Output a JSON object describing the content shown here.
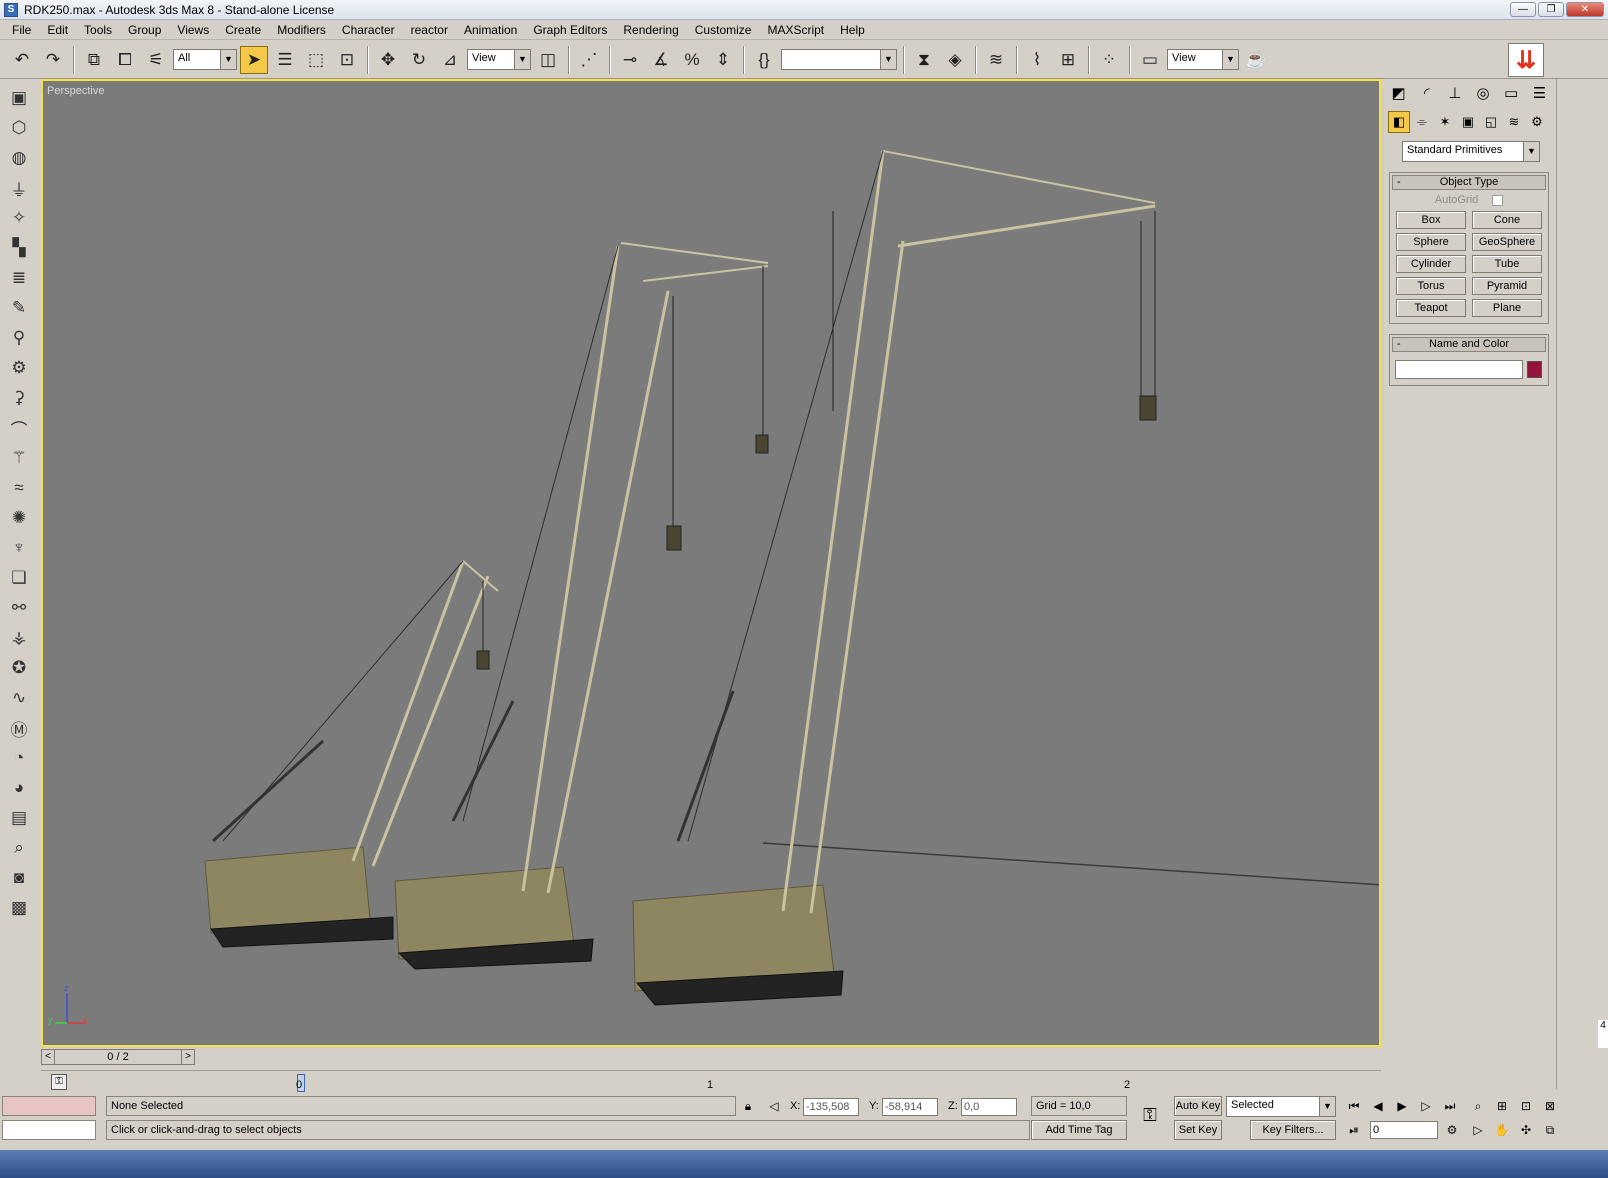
{
  "window": {
    "title": "RDK250.max - Autodesk 3ds Max 8  - Stand-alone License",
    "app_icon": "S",
    "minimize": "—",
    "maximize": "❐",
    "close": "✕"
  },
  "menu": [
    "File",
    "Edit",
    "Tools",
    "Group",
    "Views",
    "Create",
    "Modifiers",
    "Character",
    "reactor",
    "Animation",
    "Graph Editors",
    "Rendering",
    "Customize",
    "MAXScript",
    "Help"
  ],
  "toolbar": {
    "selection_filter": "All",
    "ref_coord_1": "View",
    "named_selection": "",
    "ref_coord_2": "View"
  },
  "viewport": {
    "label": "Perspective",
    "axis_z": "z",
    "axis_x": "x",
    "axis_y": "y"
  },
  "command_panel": {
    "category": "Standard Primitives",
    "object_type": {
      "title": "Object Type",
      "autogrid": "AutoGrid",
      "buttons": [
        "Box",
        "Cone",
        "Sphere",
        "GeoSphere",
        "Cylinder",
        "Tube",
        "Torus",
        "Pyramid",
        "Teapot",
        "Plane"
      ]
    },
    "name_color": {
      "title": "Name and Color",
      "name_value": "",
      "color": "#94123b"
    },
    "rollout_toggle": "-"
  },
  "timeline": {
    "frame_counter": "0 / 2",
    "ticks": [
      "0",
      "1",
      "2"
    ],
    "prev": "<",
    "next": ">"
  },
  "status": {
    "selection": "None Selected",
    "prompt": "Click or click-and-drag to select objects",
    "x_label": "X:",
    "x_value": "-135,508",
    "y_label": "Y:",
    "y_value": "-58,914",
    "z_label": "Z:",
    "z_value": "0,0",
    "grid": "Grid = 10,0",
    "add_time_tag": "Add Time Tag",
    "auto_key": "Auto Key",
    "set_key": "Set Key",
    "key_mode": "Selected",
    "key_filters": "Key Filters...",
    "current_frame": "0",
    "edge_number": "4"
  }
}
